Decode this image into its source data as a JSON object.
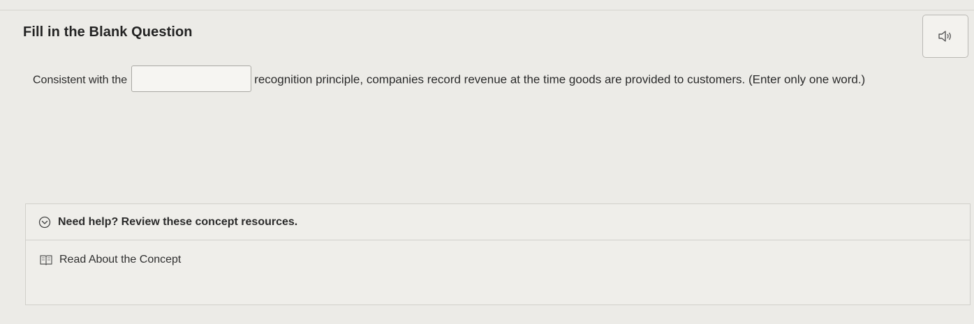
{
  "question": {
    "title": "Fill in the Blank Question",
    "text_before": "Consistent with the",
    "text_after": "recognition principle, companies record revenue at the time goods are provided to customers. (Enter only one word.)",
    "blank_value": ""
  },
  "audio": {
    "icon": "speaker-icon"
  },
  "help": {
    "header_label": "Need help? Review these concept resources.",
    "header_icon": "chevron-down-circle-icon",
    "resources": [
      {
        "label": "Read About the Concept",
        "icon": "book-icon"
      }
    ]
  }
}
